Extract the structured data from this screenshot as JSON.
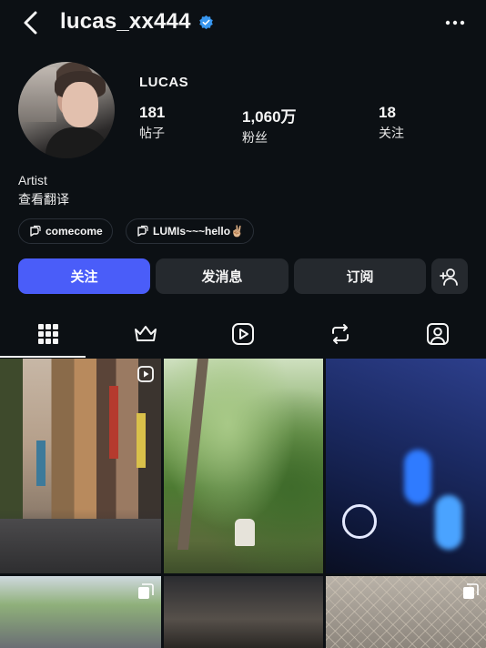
{
  "header": {
    "username": "lucas_xx444",
    "verified": true,
    "accent_color": "#3897f0"
  },
  "profile": {
    "display_name": "LUCAS",
    "stats": [
      {
        "value": "181",
        "label": "帖子"
      },
      {
        "value": "1,060万",
        "label": "粉丝"
      },
      {
        "value": "18",
        "label": "关注"
      }
    ],
    "bio": "Artist",
    "translate_label": "查看翻译"
  },
  "chips": [
    {
      "icon": "threads-icon",
      "label": "comecome"
    },
    {
      "icon": "threads-icon",
      "label": "LUMIs~~~hello✌🏼"
    }
  ],
  "actions": {
    "follow_label": "关注",
    "message_label": "发消息",
    "subscribe_label": "订阅",
    "follow_color": "#4a5df9"
  },
  "tabs": [
    {
      "icon": "grid-icon",
      "active": true
    },
    {
      "icon": "crown-icon",
      "active": false
    },
    {
      "icon": "reels-icon",
      "active": false
    },
    {
      "icon": "repost-icon",
      "active": false
    },
    {
      "icon": "tagged-icon",
      "active": false
    }
  ],
  "posts": [
    {
      "type": "video",
      "scene": "city street"
    },
    {
      "type": "photo",
      "scene": "forest"
    },
    {
      "type": "photo",
      "scene": "music player screen"
    },
    {
      "type": "carousel",
      "scene": "people outdoors"
    },
    {
      "type": "photo",
      "scene": "dark interior"
    },
    {
      "type": "carousel",
      "scene": "chain-link fence"
    }
  ]
}
